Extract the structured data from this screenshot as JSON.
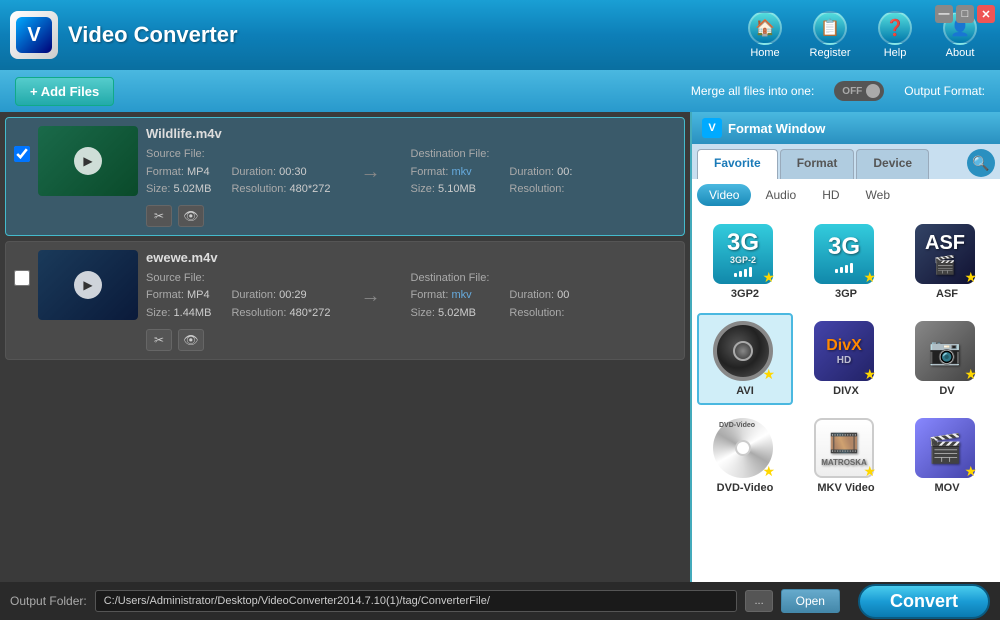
{
  "app": {
    "title": "Video Converter",
    "logo_letter": "V"
  },
  "nav": {
    "items": [
      {
        "id": "home",
        "label": "Home",
        "icon": "🏠"
      },
      {
        "id": "register",
        "label": "Register",
        "icon": "📋"
      },
      {
        "id": "help",
        "label": "Help",
        "icon": "❓"
      },
      {
        "id": "about",
        "label": "About",
        "icon": "👤"
      }
    ]
  },
  "toolbar": {
    "add_files": "+ Add Files",
    "merge_label": "Merge all files into one:",
    "toggle_state": "OFF",
    "output_format_label": "Output Format:"
  },
  "files": [
    {
      "name": "Wildlife.m4v",
      "thumb_color": "teal",
      "source": {
        "format": "MP4",
        "duration": "00:30",
        "size": "5.02MB",
        "resolution": "480*272"
      },
      "dest": {
        "format": "mkv",
        "duration": "00:",
        "size": "5.10MB",
        "resolution": ""
      }
    },
    {
      "name": "ewewe.m4v",
      "thumb_color": "blue",
      "source": {
        "format": "MP4",
        "duration": "00:29",
        "size": "1.44MB",
        "resolution": "480*272"
      },
      "dest": {
        "format": "mkv",
        "duration": "00",
        "size": "5.02MB",
        "resolution": ""
      }
    }
  ],
  "format_window": {
    "title": "Format Window",
    "tabs": [
      "Favorite",
      "Format",
      "Device"
    ],
    "active_tab": "Favorite",
    "sub_tabs": [
      "Video",
      "Audio",
      "HD",
      "Web"
    ],
    "active_sub": "Video",
    "formats": [
      {
        "id": "3gp2",
        "label": "3GP2",
        "type": "3gp"
      },
      {
        "id": "3gp",
        "label": "3GP",
        "type": "3gp"
      },
      {
        "id": "asf",
        "label": "ASF",
        "type": "asf"
      },
      {
        "id": "avi",
        "label": "AVI",
        "type": "avi",
        "selected": true
      },
      {
        "id": "divx",
        "label": "DIVX",
        "type": "divx"
      },
      {
        "id": "dv",
        "label": "DV",
        "type": "dv"
      },
      {
        "id": "dvd-video",
        "label": "DVD-Video",
        "type": "dvd"
      },
      {
        "id": "mkv",
        "label": "MKV Video",
        "type": "mkv"
      },
      {
        "id": "mov",
        "label": "MOV",
        "type": "mov"
      }
    ]
  },
  "bottom": {
    "output_folder_label": "Output Folder:",
    "output_path": "C:/Users/Administrator/Desktop/VideoConverter2014.7.10(1)/tag/ConverterFile/",
    "browse_label": "...",
    "open_label": "Open",
    "convert_label": "Convert"
  }
}
